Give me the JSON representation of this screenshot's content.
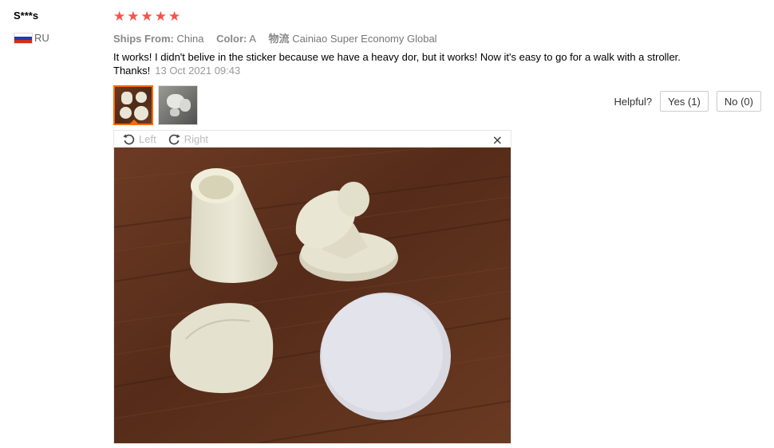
{
  "reviewer": {
    "name": "S***s",
    "country": "RU",
    "flag": [
      "#ffffff",
      "#1c3fa8",
      "#d52b1e"
    ]
  },
  "rating": {
    "stars": 5,
    "glyph": "★",
    "color": "#f5534a"
  },
  "meta": {
    "ships_from_label": "Ships From:",
    "ships_from_value": "China",
    "color_label": "Color:",
    "color_value": "A",
    "logistics_label": "物流",
    "logistics_value": "Cainiao Super Economy Global"
  },
  "review": {
    "text": "It works! I didn't belive in the sticker because we have a heavy dor, but it works! Now it's easy to go for a walk with a stroller. Thanks!",
    "date": "13 Oct 2021 09:43"
  },
  "thumbnails": [
    {
      "icon": "photo-icon"
    },
    {
      "icon": "photo-icon"
    }
  ],
  "helpful": {
    "label": "Helpful?",
    "yes": "Yes (1)",
    "no": "No (0)"
  },
  "viewer": {
    "rotate_left": "Left",
    "rotate_right": "Right",
    "close": "×"
  },
  "colors": {
    "accent": "#ff6a00",
    "star": "#f5534a"
  }
}
